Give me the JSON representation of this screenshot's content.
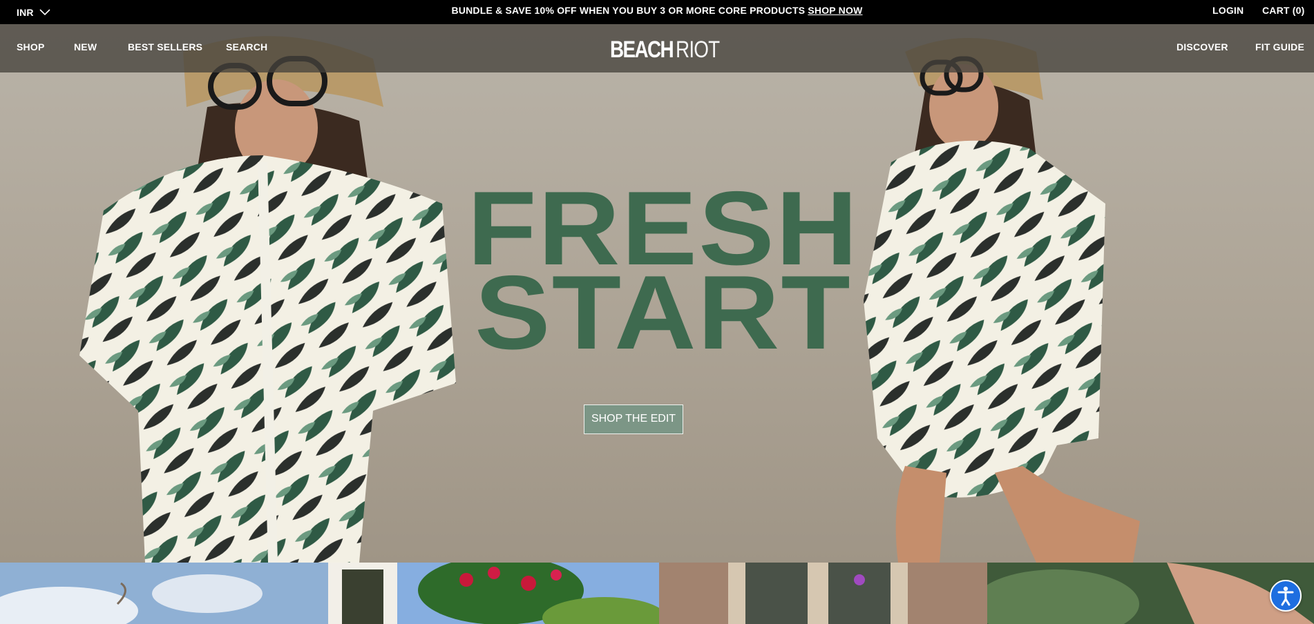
{
  "announcement": {
    "currency": "INR",
    "promo_text": "BUNDLE & SAVE 10% OFF WHEN YOU BUY 3 OR MORE CORE PRODUCTS ",
    "promo_link": "SHOP NOW",
    "login": "LOGIN",
    "cart": "CART (0)"
  },
  "nav": {
    "left": [
      "SHOP",
      "NEW",
      "BEST SELLERS",
      "SEARCH"
    ],
    "right": [
      "DISCOVER",
      "FIT GUIDE"
    ],
    "logo_bold": "BEACH",
    "logo_light": "RIOT"
  },
  "hero": {
    "headline_line1": "FRESH",
    "headline_line2": "START",
    "cta": "SHOP THE EDIT",
    "headline_color": "#3e6a4f"
  },
  "icons": {
    "currency_dropdown": "chevron-down-icon",
    "accessibility": "accessibility-icon"
  }
}
